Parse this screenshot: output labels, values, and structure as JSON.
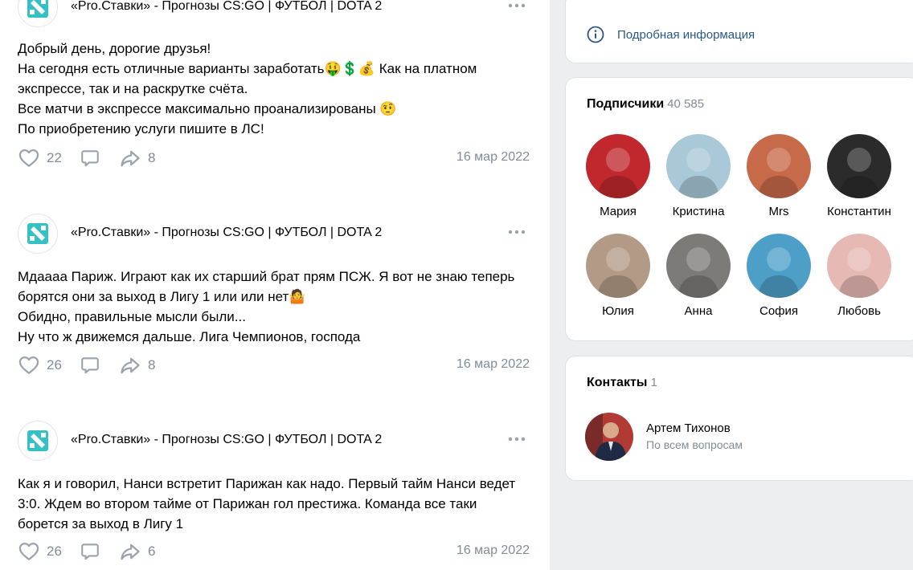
{
  "group_name": "«Pro.Ставки» - Прогнозы CS:GO | ФУТБОЛ | DOTA 2",
  "posts": [
    {
      "text": "Добрый день, дорогие друзья!\nНа сегодня есть отличные варианты заработать🤑💲💰 Как на платном экспрессе, так и на раскрутке счёта.\nВсе матчи в экспрессе максимально проанализированы 🤨\nПо приобретению услуги пишите в ЛС!",
      "likes": "22",
      "shares": "8",
      "date": "16 мар 2022"
    },
    {
      "text": "Мдаааа Париж. Играют как их старший брат прям ПСЖ. Я вот не знаю теперь борятся они за выход в Лигу 1 или или нет🤷\nОбидно, правильные мысли были...\nНу что ж движемся дальше. Лига Чемпионов, господа",
      "likes": "26",
      "shares": "8",
      "date": "16 мар 2022"
    },
    {
      "text": "Как я и говорил, Нанси встретит Парижан как надо. Первый тайм Нанси ведет 3:0. Ждем во втором тайме от Парижан гол престижа. Команда все таки борется за выход в Лигу 1",
      "likes": "26",
      "shares": "6",
      "date": "16 мар 2022"
    }
  ],
  "info": {
    "label": "Подробная информация"
  },
  "subscribers": {
    "title": "Подписчики",
    "count": "40 585",
    "people": [
      {
        "name": "Мария",
        "color": "#c0282d"
      },
      {
        "name": "Кристина",
        "color": "#a9c8d8"
      },
      {
        "name": "Mrs",
        "color": "#c76a4a"
      },
      {
        "name": "Константин",
        "color": "#2b2b2b"
      },
      {
        "name": "Юлия",
        "color": "#b39a86"
      },
      {
        "name": "Анна",
        "color": "#7d7b78"
      },
      {
        "name": "София",
        "color": "#4d9fc8"
      },
      {
        "name": "Любовь",
        "color": "#e6b9b4"
      }
    ]
  },
  "contacts": {
    "title": "Контакты",
    "count": "1",
    "person": {
      "name": "Артем Тихонов",
      "role": "По всем вопросам"
    }
  },
  "colors": {
    "accent": "#2a5885",
    "muted": "#818c99",
    "icon": "#99a2ad"
  }
}
